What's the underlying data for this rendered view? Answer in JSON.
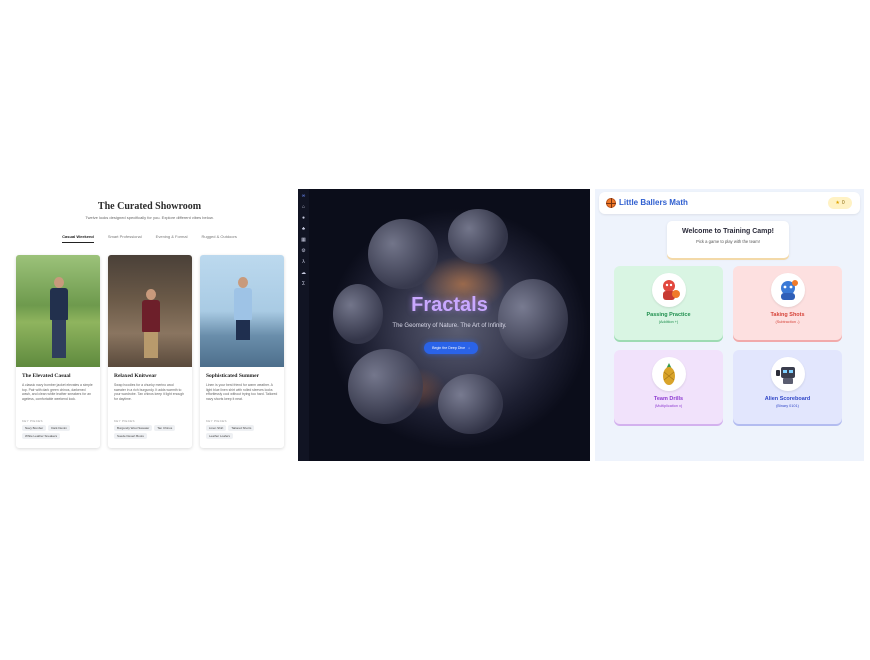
{
  "showroom": {
    "title": "The Curated Showroom",
    "subtitle": "Twelve looks designed specifically for you. Explore different vibes below.",
    "tabs": [
      {
        "label": "Casual Weekend",
        "active": true
      },
      {
        "label": "Smart Professional",
        "active": false
      },
      {
        "label": "Evening & Formal",
        "active": false
      },
      {
        "label": "Rugged & Outdoors",
        "active": false
      }
    ],
    "cards": [
      {
        "title": "The Elevated Casual",
        "description": "A classic navy bomber jacket elevates a simple top. Pair with dark green chinos, darkened wash, and clean white leather sneakers for an ageless, comfortable weekend look.",
        "key_label": "KEY PIECES",
        "pieces": [
          "Navy Bomber",
          "Dark Denim",
          "White Leather Sneakers"
        ]
      },
      {
        "title": "Relaxed Knitwear",
        "description": "Swap hoodies for a chunky merino wool sweater in a rich burgundy. It adds warmth to your wardrobe. Tan chinos keep it light enough for daytime.",
        "key_label": "KEY PIECES",
        "pieces": [
          "Burgundy Wool Sweater",
          "Tan Chinos",
          "Suede Desert Boots"
        ]
      },
      {
        "title": "Sophisticated Summer",
        "description": "Linen is your best friend for warm weather. A light blue linen shirt with rolled sleeves looks effortlessly cool without trying too hard. Tailored navy shorts keep it neat.",
        "key_label": "KEY PIECES",
        "pieces": [
          "Linen Shirt",
          "Tailored Shorts",
          "Leather Loafers"
        ]
      }
    ]
  },
  "fractals": {
    "sidebar_icons": [
      "infinity-logo-icon",
      "home-icon",
      "pin-icon",
      "tree-icon",
      "grid-icon",
      "gear-icon",
      "lambda-icon",
      "cloud-icon",
      "sigma-icon"
    ],
    "heading": "Fractals",
    "tagline": "The Geometry of Nature. The Art of Infinity.",
    "cta_label": "Begin the Deep Dive",
    "accent": "#2a63e8"
  },
  "math_app": {
    "app_title": "Little Ballers Math",
    "stars": "0",
    "welcome_title": "Welcome to Training Camp!",
    "welcome_sub": "Pick a game to play with the team!",
    "games": [
      {
        "name": "Passing Practice",
        "op": "(Addition +)",
        "color": "#1f8f4e"
      },
      {
        "name": "Taking Shots",
        "op": "(Subtraction -)",
        "color": "#d6443a"
      },
      {
        "name": "Team Drills",
        "op": "(Multiplication x)",
        "color": "#8e3bd1"
      },
      {
        "name": "Alien Scoreboard",
        "op": "(Binary 0101)",
        "color": "#3248c8"
      }
    ]
  }
}
